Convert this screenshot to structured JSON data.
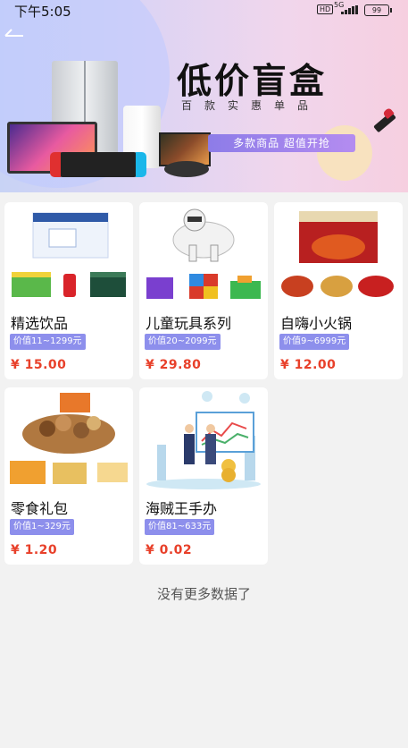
{
  "status_bar": {
    "time": "下午5:05",
    "hd": "HD",
    "network": "5G",
    "battery": "99"
  },
  "banner": {
    "title": "低价盲盒",
    "subtitle": "百款实惠单品",
    "tagline": "多款商品 超值开抢",
    "back_icon": "back-arrow-icon"
  },
  "products": [
    {
      "name": "精选饮品",
      "value_range": "价值11~1299元",
      "price": "¥ 15.00"
    },
    {
      "name": "儿童玩具系列",
      "value_range": "价值20~2099元",
      "price": "¥ 29.80"
    },
    {
      "name": "自嗨小火锅",
      "value_range": "价值9~6999元",
      "price": "¥ 12.00"
    },
    {
      "name": "零食礼包",
      "value_range": "价值1~329元",
      "price": "¥ 1.20"
    },
    {
      "name": "海贼王手办",
      "value_range": "价值81~633元",
      "price": "¥ 0.02"
    }
  ],
  "footer": {
    "no_more": "没有更多数据了"
  },
  "colors": {
    "price": "#e8402a",
    "badge": "#8d8fec",
    "background": "#f2f2f2"
  }
}
